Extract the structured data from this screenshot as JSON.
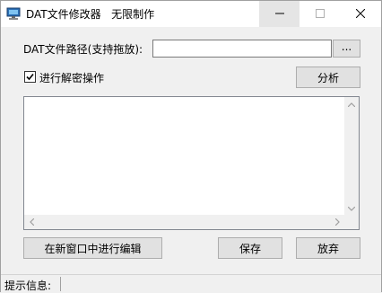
{
  "window": {
    "title": "DAT文件修改器   无限制作"
  },
  "path": {
    "label": "DAT文件路径(支持拖放):",
    "value": "",
    "browse_label": "..."
  },
  "decrypt": {
    "label": "进行解密操作",
    "checked_glyph": "✓"
  },
  "buttons": {
    "analyze": "分析",
    "edit_new_window": "在新窗口中进行编辑",
    "save": "保存",
    "discard": "放弃"
  },
  "editor": {
    "content": ""
  },
  "statusbar": {
    "label": "提示信息:",
    "message": ""
  },
  "icons": {
    "app": "computer-monitor-icon",
    "minimize": "minimize-icon",
    "maximize": "maximize-icon",
    "close": "close-icon",
    "checkbox": "checkmark-icon"
  }
}
